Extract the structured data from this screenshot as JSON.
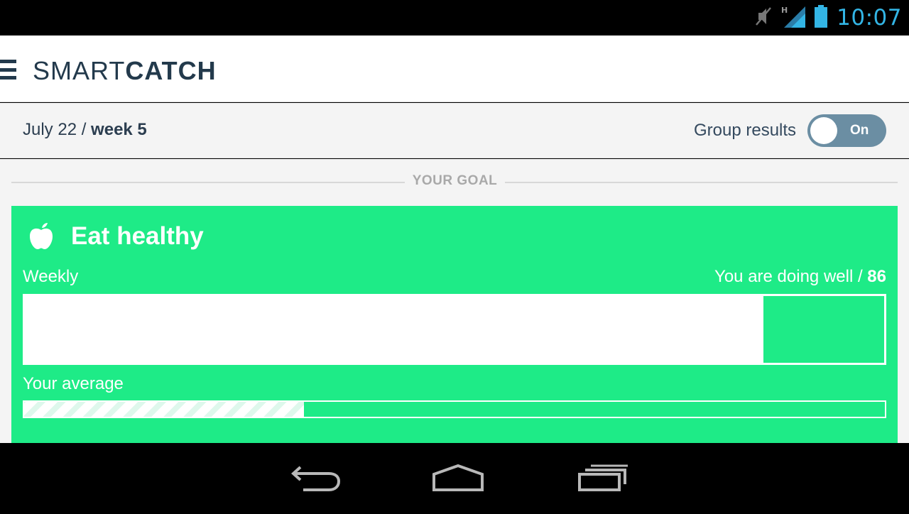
{
  "status_bar": {
    "time": "10:07",
    "icons": [
      "mute-icon",
      "signal-h-icon",
      "battery-icon"
    ],
    "accent_color": "#33b5e5"
  },
  "header": {
    "logo_light": "SMART",
    "logo_bold": "CATCH",
    "brand_color": "#233a4c"
  },
  "sub_header": {
    "date": "July 22 / ",
    "week": "week 5",
    "group_results_label": "Group results",
    "toggle_state": "On",
    "toggle_color": "#6b8ea3"
  },
  "goal_section": {
    "heading": "YOUR GOAL"
  },
  "goal_card": {
    "icon": "apple-icon",
    "title": "Eat healthy",
    "weekly_label": "Weekly",
    "status_text": "You are doing well / ",
    "score": "86",
    "weekly_progress_fraction": 0.14,
    "average_label": "Your average",
    "average_progress_fraction": 0.675,
    "card_color": "#1eeb87"
  },
  "nav_bar": {
    "buttons": [
      "back-icon",
      "home-icon",
      "recent-apps-icon"
    ]
  }
}
